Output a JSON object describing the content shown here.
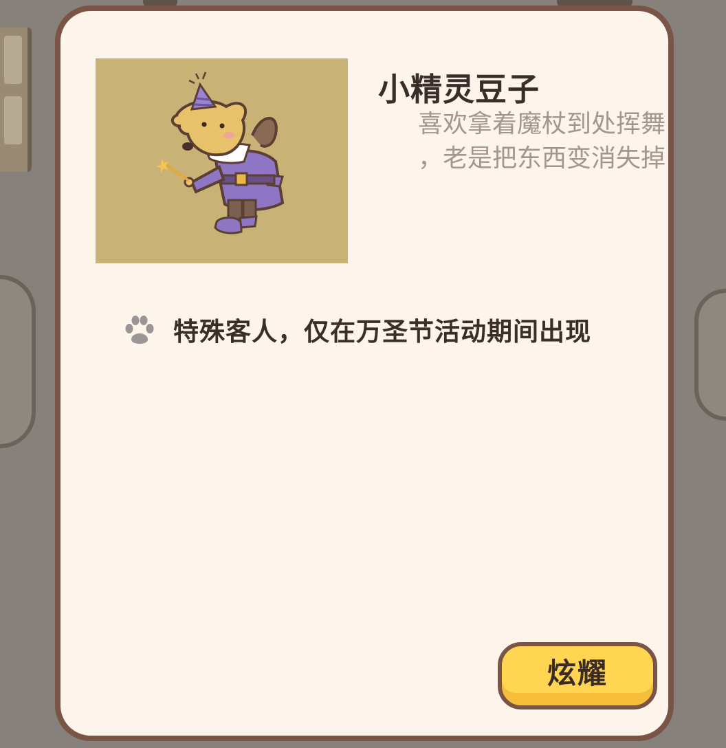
{
  "character": {
    "name": "小精灵豆子",
    "description_line1": "喜欢拿着魔杖到处挥舞",
    "description_line2": "，老是把东西变消失掉"
  },
  "info": {
    "icon": "paw-icon",
    "note": "特殊客人，仅在万圣节活动期间出现"
  },
  "actions": {
    "show_off_label": "炫耀"
  },
  "colors": {
    "dialog_bg": "#fdf5ec",
    "dialog_border": "#7a5446",
    "portrait_bg": "#c8b276",
    "button_yellow": "#ffd552",
    "costume_purple": "#8e76c4"
  }
}
